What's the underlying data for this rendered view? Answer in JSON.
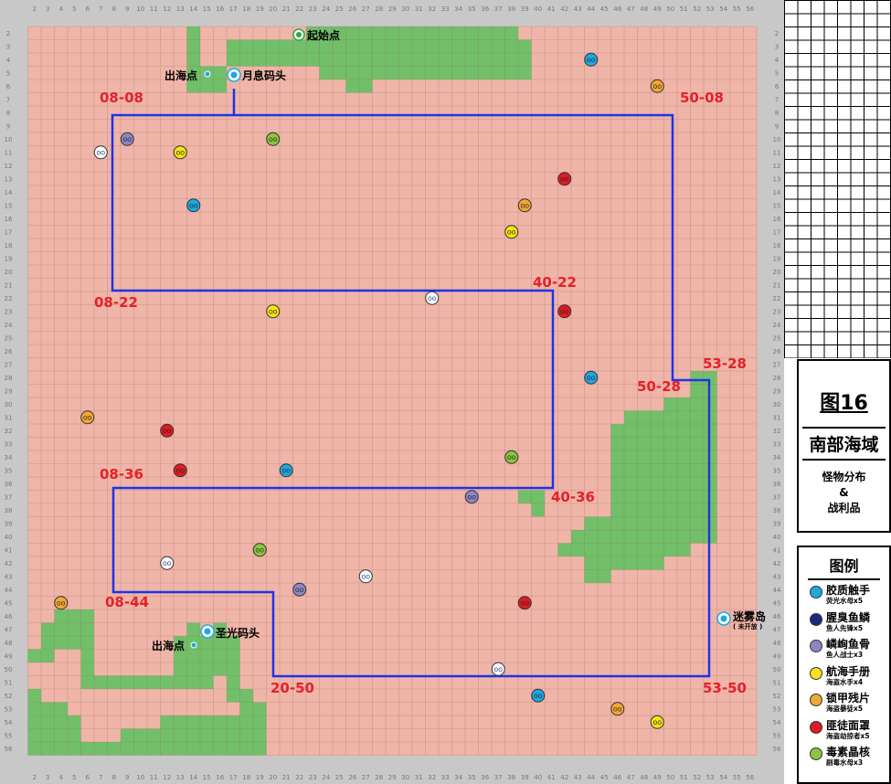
{
  "column_numbers": [
    "2",
    "3",
    "4",
    "5",
    "6",
    "7",
    "8",
    "9",
    "10",
    "11",
    "12",
    "13",
    "14",
    "15",
    "16",
    "17",
    "18",
    "19",
    "20",
    "21",
    "22",
    "23",
    "24",
    "25",
    "26",
    "27",
    "28",
    "29",
    "30",
    "31",
    "32",
    "33",
    "34",
    "35",
    "36",
    "37",
    "38",
    "39",
    "40",
    "41",
    "42",
    "43",
    "44",
    "45",
    "46",
    "47",
    "48",
    "49",
    "50",
    "51",
    "52",
    "53",
    "54",
    "55",
    "56"
  ],
  "row_numbers": [
    "2",
    "3",
    "4",
    "5",
    "6",
    "7",
    "8",
    "9",
    "10",
    "11",
    "12",
    "13",
    "14",
    "15",
    "16",
    "17",
    "18",
    "19",
    "20",
    "21",
    "22",
    "23",
    "24",
    "25",
    "26",
    "27",
    "28",
    "29",
    "30",
    "31",
    "32",
    "33",
    "34",
    "35",
    "36",
    "37",
    "38",
    "39",
    "40",
    "41",
    "42",
    "43",
    "44",
    "45",
    "46",
    "47",
    "48",
    "49",
    "50",
    "51",
    "52",
    "53",
    "54",
    "55",
    "56"
  ],
  "colors": {
    "sea": "#efb5a8",
    "land": "#72bf6a",
    "route": "#1f33e6",
    "coord_label": "#e5202a",
    "frame": "#c8c8c8"
  },
  "place_labels": {
    "start": "起始点",
    "exit_north": "出海点",
    "moon_dock": "月息码头",
    "exit_south": "出海点",
    "holy_dock": "圣光码头",
    "mist_island": "迷雾岛",
    "mist_island_note": "( 未开放 )"
  },
  "coord_labels": [
    "08-08",
    "50-08",
    "08-22",
    "40-22",
    "53-28",
    "50-28",
    "08-36",
    "40-36",
    "08-44",
    "20-50",
    "53-50"
  ],
  "title": {
    "figure": "图16",
    "region": "南部海域",
    "line1": "怪物分布",
    "line2": "&",
    "line3": "战利品"
  },
  "legend": {
    "title": "图例",
    "items": [
      {
        "name": "胶质触手",
        "drop": "荧光水母x5",
        "color": "#1ea8e0",
        "icon": "tentacle-icon"
      },
      {
        "name": "腥臭鱼鳞",
        "drop": "鱼人先锋x5",
        "color": "#1b2a7a",
        "icon": "scale-icon"
      },
      {
        "name": "嶙峋鱼骨",
        "drop": "鱼人战士x3",
        "color": "#8e86c4",
        "icon": "fishbone-icon"
      },
      {
        "name": "航海手册",
        "drop": "海盗水手x4",
        "color": "#f5e21a",
        "icon": "manual-icon"
      },
      {
        "name": "锁甲残片",
        "drop": "海盗暴徒x5",
        "color": "#f2a735",
        "icon": "armor-icon"
      },
      {
        "name": "匪徒面罩",
        "drop": "海盗劫掠者x5",
        "color": "#e01b24",
        "icon": "mask-icon"
      },
      {
        "name": "毒素晶核",
        "drop": "剧毒水母x3",
        "color": "#8cc63f",
        "icon": "crystal-icon"
      }
    ]
  },
  "markers": [
    {
      "type": 0,
      "col": 44,
      "row": 4
    },
    {
      "type": 4,
      "col": 49,
      "row": 6
    },
    {
      "type": 2,
      "col": 9,
      "row": 10
    },
    {
      "type": 6,
      "col": 20,
      "row": 10
    },
    {
      "type": 1,
      "col": 7,
      "row": 11
    },
    {
      "type": 3,
      "col": 13,
      "row": 11
    },
    {
      "type": 5,
      "col": 42,
      "row": 13
    },
    {
      "type": 0,
      "col": 14,
      "row": 15
    },
    {
      "type": 4,
      "col": 39,
      "row": 15
    },
    {
      "type": 3,
      "col": 38,
      "row": 17
    },
    {
      "type": 1,
      "col": 32,
      "row": 22
    },
    {
      "type": 3,
      "col": 20,
      "row": 23
    },
    {
      "type": 5,
      "col": 42,
      "row": 23
    },
    {
      "type": 0,
      "col": 44,
      "row": 28
    },
    {
      "type": 4,
      "col": 6,
      "row": 31
    },
    {
      "type": 5,
      "col": 12,
      "row": 32
    },
    {
      "type": 6,
      "col": 38,
      "row": 34
    },
    {
      "type": 5,
      "col": 13,
      "row": 35
    },
    {
      "type": 0,
      "col": 21,
      "row": 35
    },
    {
      "type": 2,
      "col": 35,
      "row": 37
    },
    {
      "type": 6,
      "col": 19,
      "row": 41
    },
    {
      "type": 1,
      "col": 12,
      "row": 42
    },
    {
      "type": 1,
      "col": 27,
      "row": 43
    },
    {
      "type": 2,
      "col": 22,
      "row": 44
    },
    {
      "type": 4,
      "col": 4,
      "row": 45
    },
    {
      "type": 5,
      "col": 39,
      "row": 45
    },
    {
      "type": 1,
      "col": 37,
      "row": 50
    },
    {
      "type": 0,
      "col": 40,
      "row": 52
    },
    {
      "type": 4,
      "col": 46,
      "row": 53
    },
    {
      "type": 3,
      "col": 49,
      "row": 54
    }
  ]
}
